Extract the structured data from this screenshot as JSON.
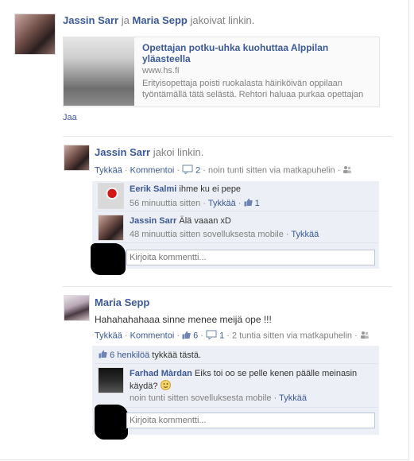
{
  "post1": {
    "actor1": "Jassin Sarr",
    "conj": "ja",
    "actor2": "Maria Sepp",
    "verb": "jakoivat linkin.",
    "link_title_line1": "Opettajan potku-uhka kuohuttaa Alppilan",
    "link_title_line2": "yläasteella",
    "link_domain": "www.hs.fi",
    "link_desc_line1": "Erityisopettaja poisti ruokalasta häiriköivän oppilaan",
    "link_desc_line2": "työntämällä tätä selästä. Rehtori haluaa purkaa opettajan",
    "share_label": "Jaa"
  },
  "story1": {
    "author": "Jassin Sarr",
    "verb": "jakoi linkin.",
    "like_label": "Tykkää",
    "comment_label": "Kommentoi",
    "comment_count": "2",
    "time": "noin tunti sitten via matkapuhelin",
    "comments": [
      {
        "author": "Eerik Salmi",
        "text": "ihme ku ei pepe",
        "time": "56 minuuttia sitten",
        "like": "Tykkää",
        "likes": "1"
      },
      {
        "author": "Jassin Sarr",
        "text": "Älä vaaan xD",
        "time": "48 minuuttia sitten sovelluksesta mobile",
        "like": "Tykkää"
      }
    ],
    "input_placeholder": "Kirjoita kommentti..."
  },
  "story2": {
    "author": "Maria Sepp",
    "text": "Hahahahahaaa sinne menee meijä ope !!!",
    "like_label": "Tykkää",
    "comment_label": "Kommentoi",
    "likes": "6",
    "comment_count": "1",
    "time": "2 tuntia sitten via matkapuhelin",
    "likes_summary": "6 henkilöä",
    "likes_summary_suffix": "tykkää tästä.",
    "comment": {
      "author": "Farhad Màrdan",
      "text_line1": "Eiks toi oo se pelle kenen päälle meinasin",
      "text_line2": "käydä?",
      "time": "noin tunti sitten sovelluksesta mobile",
      "like": "Tykkää"
    },
    "input_placeholder": "Kirjoita kommentti..."
  },
  "colors": {
    "link": "#3b5998",
    "comment_bg": "#eceff5",
    "meta": "#808080"
  },
  "icons": [
    "comment-icon",
    "friends-icon",
    "thumbs-up-icon",
    "smiley-icon"
  ]
}
